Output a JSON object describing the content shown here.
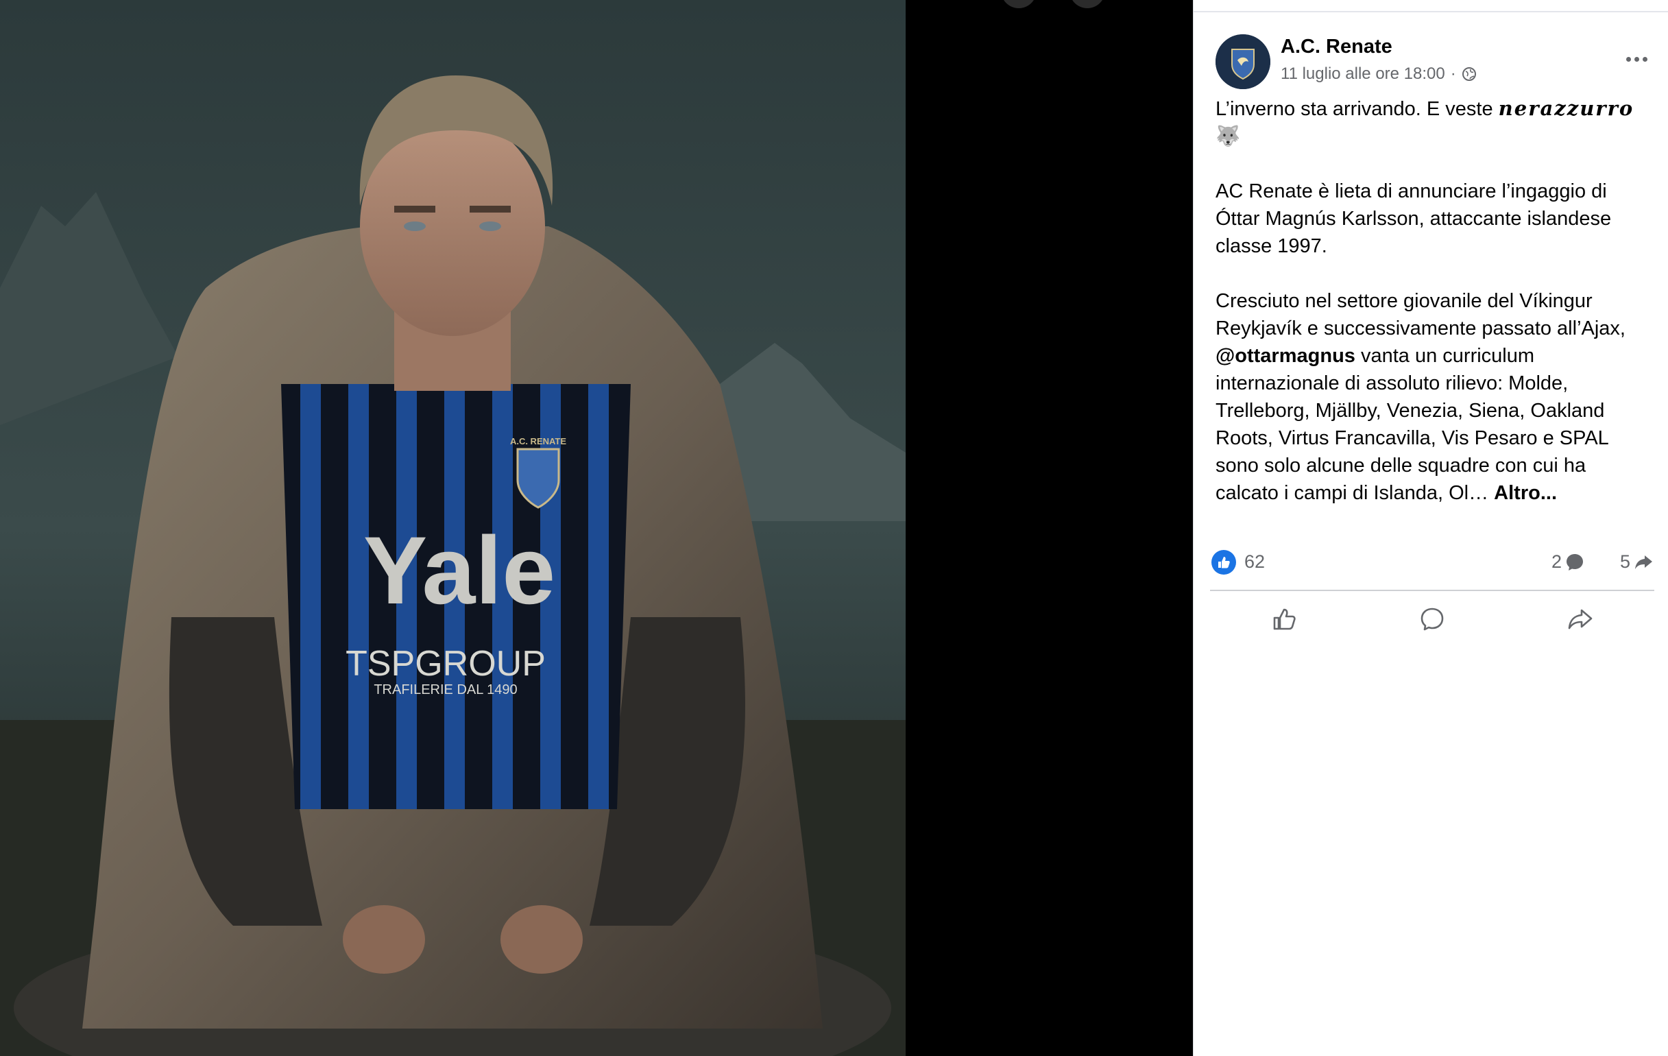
{
  "post": {
    "page_name": "A.C. Renate",
    "timestamp": "11 luglio alle ore 18:00",
    "separator": "·",
    "audience_icon": "globe-icon",
    "text": {
      "line1_prefix": "L’inverno sta arrivando. E veste ",
      "line1_styled": "nerazzurro",
      "line1_emoji": "🐺",
      "p2": "AC Renate è lieta di annunciare l’ingaggio di Óttar Magnús Karlsson, attaccante islandese classe 1997.",
      "p3_before": "Cresciuto nel settore giovanile del Víkingur Reykjavík e successivamente passato all’Ajax,",
      "p3_mention": "@ottarmagnus",
      "p3_after": " vanta un curriculum internazionale di assoluto rilievo: Molde, Trelleborg, Mjällby, Venezia, Siena, Oakland Roots, Virtus Francavilla, Vis Pesaro e SPAL sono solo alcune delle squadre con cui ha calcato i campi di Islanda, Ol… ",
      "more_link": "Altro..."
    },
    "reactions": {
      "like_count": "62",
      "comment_count": "2",
      "share_count": "5"
    },
    "actions": [
      "like",
      "comment",
      "share"
    ]
  },
  "image": {
    "jersey_brand": "Yale",
    "jersey_sponsor": "TSPGROUP",
    "jersey_sponsor_tagline": "TRAFILERIE DAL 1490",
    "crest_text": "A.C. RENATE"
  },
  "colors": {
    "accent_blue": "#1b74e4",
    "text_primary": "#050505",
    "text_secondary": "#65676b"
  }
}
